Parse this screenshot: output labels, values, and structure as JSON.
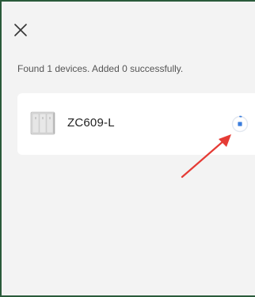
{
  "header": {
    "close_icon": "close-icon"
  },
  "result": {
    "status_text": "Found 1 devices. Added 0 successfully."
  },
  "devices": [
    {
      "name": "ZC609-L",
      "thumbnail_icon": "smart-switch-panel-icon",
      "status_icon": "adding-progress-icon",
      "accent_color": "#3b7ddd"
    }
  ],
  "annotation": {
    "arrow_color": "#e53b35"
  }
}
